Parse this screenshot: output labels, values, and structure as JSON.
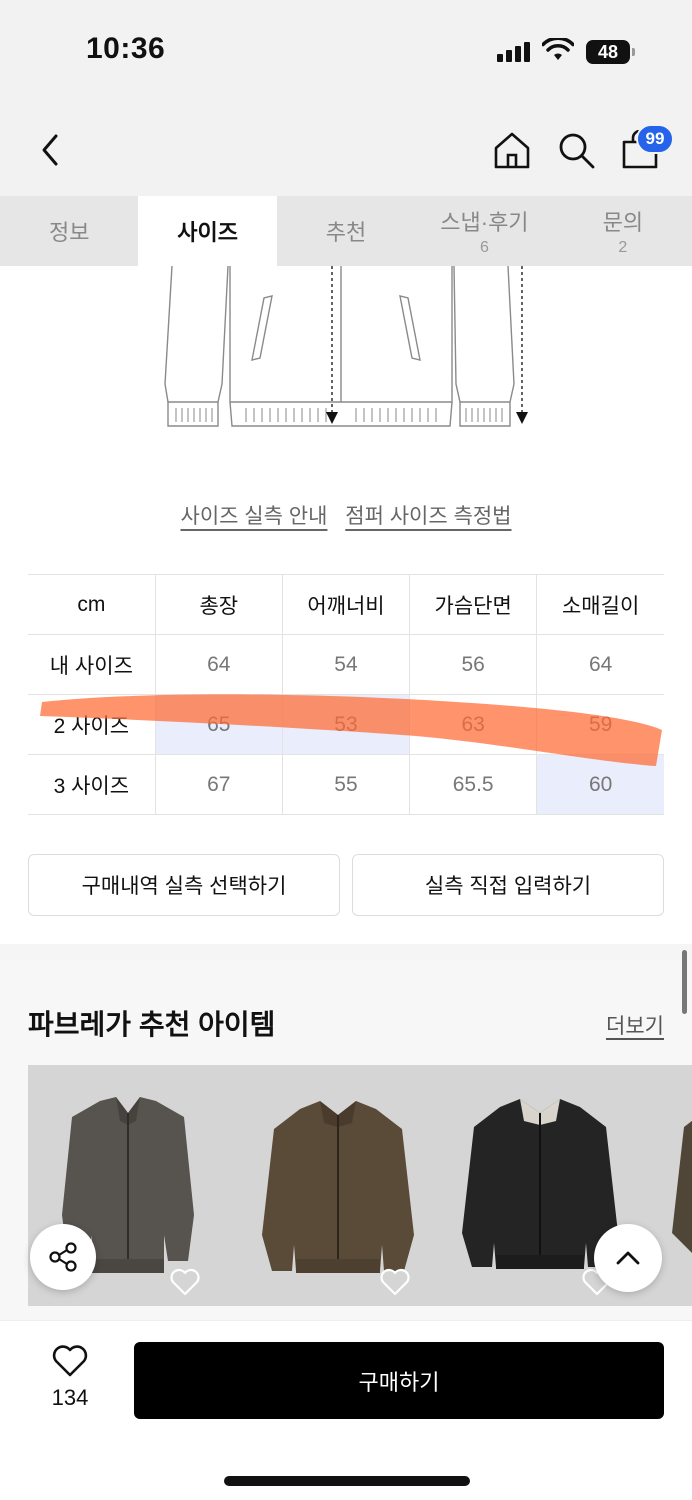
{
  "status": {
    "time": "10:36",
    "battery": "48"
  },
  "nav": {
    "cart_count": "99"
  },
  "tabs": [
    {
      "label": "정보",
      "count": ""
    },
    {
      "label": "사이즈",
      "count": ""
    },
    {
      "label": "추천",
      "count": ""
    },
    {
      "label": "스냅·후기",
      "count": "6"
    },
    {
      "label": "문의",
      "count": "2"
    }
  ],
  "guide": {
    "actual_size": "사이즈 실측 안내",
    "measure_method": "점퍼 사이즈 측정법"
  },
  "size_table": {
    "unit": "cm",
    "headers": [
      "총장",
      "어깨너비",
      "가슴단면",
      "소매길이"
    ],
    "rows": [
      {
        "label": "내 사이즈",
        "values": [
          "64",
          "54",
          "56",
          "64"
        ]
      },
      {
        "label": "2 사이즈",
        "values": [
          "65",
          "53",
          "63",
          "59"
        ]
      },
      {
        "label": "3 사이즈",
        "values": [
          "67",
          "55",
          "65.5",
          "60"
        ]
      }
    ]
  },
  "actions": {
    "select_history": "구매내역 실측 선택하기",
    "direct_input": "실측 직접 입력하기"
  },
  "recommend": {
    "title": "파브레가 추천 아이템",
    "more": "더보기"
  },
  "bottom": {
    "likes": "134",
    "buy": "구매하기"
  },
  "colors": {
    "accent": "#2563eb",
    "highlight_cell": "#e9edfc",
    "marker_stroke": "#ff6a33",
    "buy_button": "#000000"
  }
}
